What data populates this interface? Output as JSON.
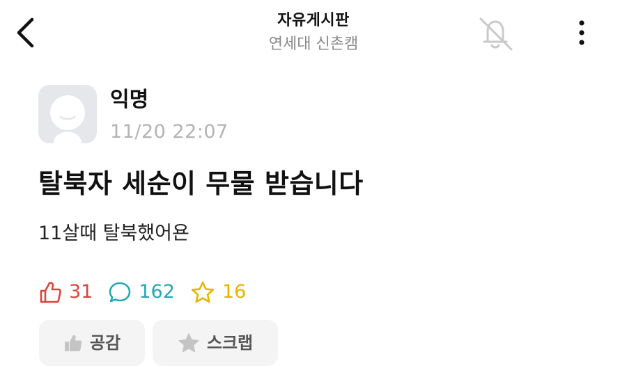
{
  "header": {
    "title": "자유게시판",
    "subtitle": "연세대 신촌캠",
    "back_icon": "chevron-left-icon",
    "notification_icon": "bell-off-icon",
    "more_icon": "more-vertical-icon"
  },
  "post": {
    "author": "익명",
    "time": "11/20 22:07",
    "title": "탈북자 세순이 무물 받습니다",
    "body": "11살때 탈북했어욘"
  },
  "stats": {
    "likes": "31",
    "comments": "162",
    "scraps": "16"
  },
  "actions": {
    "like_label": "공감",
    "scrap_label": "스크랩"
  },
  "colors": {
    "like": "#d9453a",
    "comment": "#25a8b0",
    "scrap": "#e6b400",
    "muted": "#b3b3b3",
    "button_bg": "#f4f4f5"
  }
}
